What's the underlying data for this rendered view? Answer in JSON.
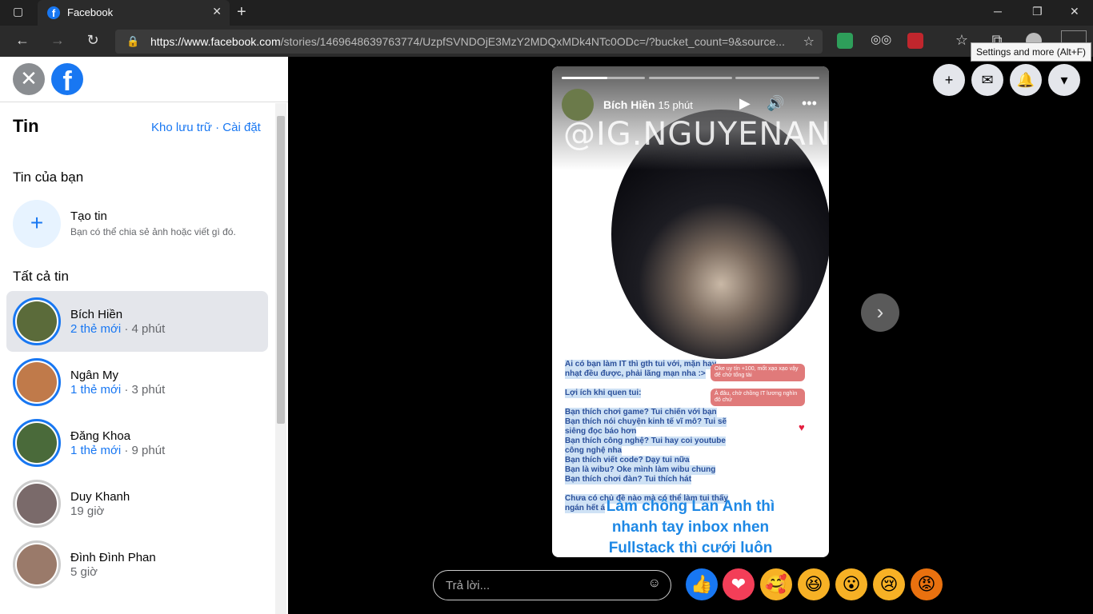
{
  "browser": {
    "tab_title": "Facebook",
    "url_domain": "https://www.facebook.com",
    "url_path": "/stories/1469648639763774/UzpfSVNDOjE3MzY2MDQxMDk4NTc0ODc=/?bucket_count=9&source...",
    "tooltip": "Settings and more (Alt+F)"
  },
  "sidebar": {
    "title": "Tin",
    "archive_link": "Kho lưu trữ",
    "separator": " · ",
    "settings_link": "Cài đặt",
    "your_stories_heading": "Tin của bạn",
    "create_title": "Tạo tin",
    "create_subtitle": "Bạn có thể chia sẻ ảnh hoặc viết gì đó.",
    "all_stories_heading": "Tất cả tin",
    "stories": [
      {
        "name": "Bích Hiền",
        "new": "2 thẻ mới",
        "time": " · 4 phút",
        "color": "#5b6b3a"
      },
      {
        "name": "Ngân My",
        "new": "1 thẻ mới",
        "time": " · 3 phút",
        "color": "#c07a4a"
      },
      {
        "name": "Đăng Khoa",
        "new": "1 thẻ mới",
        "time": " · 9 phút",
        "color": "#4a6a3a"
      },
      {
        "name": "Duy Khanh",
        "new": "",
        "time": "19 giờ",
        "color": "#7a6a6a"
      },
      {
        "name": "Đình Đình Phan",
        "new": "",
        "time": "5 giờ",
        "color": "#9a7a6a"
      }
    ]
  },
  "story": {
    "author": "Bích Hiền",
    "time": "15 phút",
    "watermark": "@IG.NGUYENANH",
    "lines": [
      "Ai có bạn làm IT thì gth tui với, mặn hay",
      "nhạt đều được, phải lãng mạn nha :>",
      "Lợi ích khi quen tui:",
      "Bạn thích chơi game? Tui chiến với bạn",
      "Bạn thích nói chuyện kinh tế vĩ mô? Tui sẽ",
      "siêng đọc báo hơn",
      "Bạn thích công nghệ? Tui hay coi youtube",
      "công nghệ nha",
      "Bạn thích viết code? Dạy tui nữa",
      "Bạn là wibu? Oke mình làm wibu chung",
      "Bạn thích chơi đàn? Tui thích hát",
      "Chưa có chủ đề nào mà có thể làm tui thấy",
      "ngán hết á"
    ],
    "chat1": "Oke uy tín +100, mốt xạo xạo vậy để chờ tổng tài",
    "chat2": "À đâu, chờ chồng IT lương nghìn đô chứ",
    "big_lines": [
      "Làm chồng Lan Anh thì",
      "nhanh tay inbox nhen",
      "Fullstack thì cưới luôn"
    ]
  },
  "reply_placeholder": "Trả lời...",
  "reactions": [
    "👍",
    "❤",
    "🥰",
    "😆",
    "😮",
    "😢",
    "😡"
  ]
}
